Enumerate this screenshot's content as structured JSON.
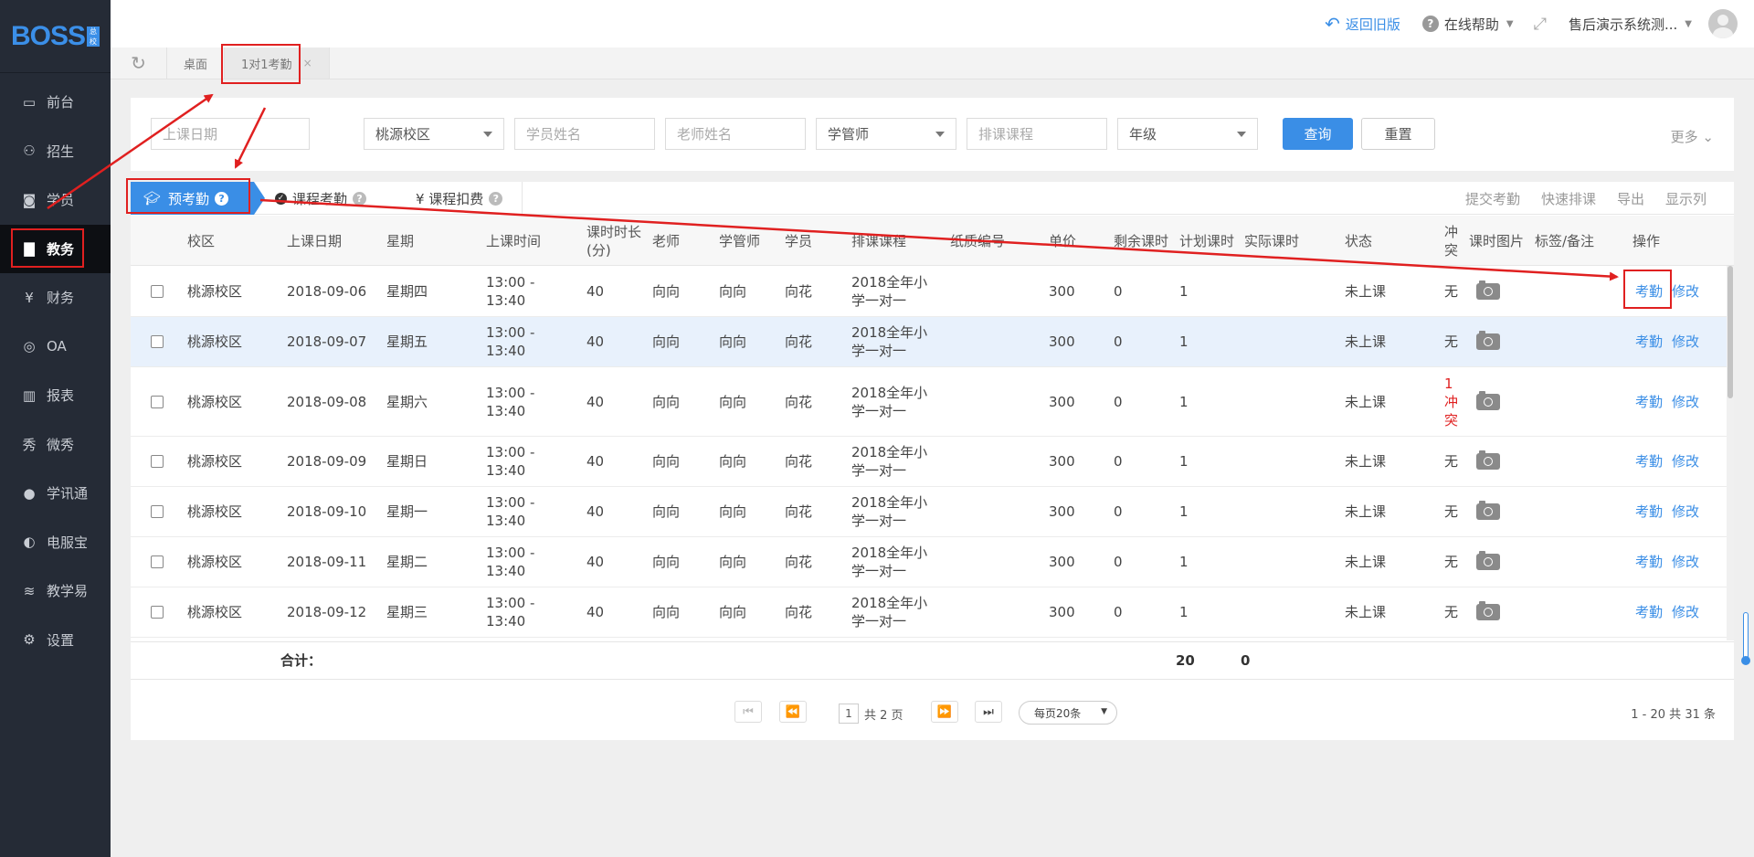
{
  "sidebar": {
    "logo": "BOSS",
    "logo_sub": "总校",
    "items": [
      {
        "label": "前台",
        "icon": "calendar-icon",
        "glyph": "▭"
      },
      {
        "label": "招生",
        "icon": "enroll-icon",
        "glyph": "⚇"
      },
      {
        "label": "学员",
        "icon": "student-icon",
        "glyph": "◙"
      },
      {
        "label": "教务",
        "icon": "book-icon",
        "glyph": "▇",
        "active": true
      },
      {
        "label": "财务",
        "icon": "finance-icon",
        "glyph": "¥"
      },
      {
        "label": "OA",
        "icon": "oa-icon",
        "glyph": "◎"
      },
      {
        "label": "报表",
        "icon": "chart-icon",
        "glyph": "▥"
      },
      {
        "label": "微秀",
        "icon": "weixiu-icon",
        "glyph": "秀"
      },
      {
        "label": "学讯通",
        "icon": "location-icon",
        "glyph": "●"
      },
      {
        "label": "电服宝",
        "icon": "phone-service-icon",
        "glyph": "◐"
      },
      {
        "label": "教学易",
        "icon": "teach-icon",
        "glyph": "≋"
      },
      {
        "label": "设置",
        "icon": "gear-icon",
        "glyph": "⚙"
      }
    ]
  },
  "topbar": {
    "back_old": "返回旧版",
    "online_help": "在线帮助",
    "user": "售后演示系统测..."
  },
  "tabs": [
    {
      "label": "桌面"
    },
    {
      "label": "1对1考勤",
      "active": true
    }
  ],
  "filters": {
    "date_placeholder": "上课日期",
    "campus": "桃源校区",
    "student_placeholder": "学员姓名",
    "teacher_placeholder": "老师姓名",
    "manager": "学管师",
    "course_placeholder": "排课课程",
    "grade": "年级",
    "query": "查询",
    "reset": "重置",
    "more": "更多"
  },
  "subtabs": {
    "pre": "预考勤",
    "course": "课程考勤",
    "deduct": "¥ 课程扣费",
    "actions": [
      "提交考勤",
      "快速排课",
      "导出",
      "显示列"
    ]
  },
  "columns": [
    "校区",
    "上课日期",
    "星期",
    "上课时间",
    "课时时长(分)",
    "老师",
    "学管师",
    "学员",
    "排课课程",
    "纸质编号",
    "单价",
    "剩余课时",
    "计划课时",
    "实际课时",
    "状态",
    "冲突",
    "课时图片",
    "标签/备注",
    "操作"
  ],
  "rows": [
    {
      "campus": "桃源校区",
      "date": "2018-09-06",
      "weekday": "星期四",
      "time": "13:00 - 13:40",
      "duration": "40",
      "teacher": "向向",
      "manager": "向向",
      "student": "向花",
      "course": "2018全年小学一对一",
      "price": "300",
      "remaining": "0",
      "planned": "1",
      "status": "未上课",
      "conflict": "无"
    },
    {
      "campus": "桃源校区",
      "date": "2018-09-07",
      "weekday": "星期五",
      "time": "13:00 - 13:40",
      "duration": "40",
      "teacher": "向向",
      "manager": "向向",
      "student": "向花",
      "course": "2018全年小学一对一",
      "price": "300",
      "remaining": "0",
      "planned": "1",
      "status": "未上课",
      "conflict": "无"
    },
    {
      "campus": "桃源校区",
      "date": "2018-09-08",
      "weekday": "星期六",
      "time": "13:00 - 13:40",
      "duration": "40",
      "teacher": "向向",
      "manager": "向向",
      "student": "向花",
      "course": "2018全年小学一对一",
      "price": "300",
      "remaining": "0",
      "planned": "1",
      "status": "未上课",
      "conflict": "1冲突"
    },
    {
      "campus": "桃源校区",
      "date": "2018-09-09",
      "weekday": "星期日",
      "time": "13:00 - 13:40",
      "duration": "40",
      "teacher": "向向",
      "manager": "向向",
      "student": "向花",
      "course": "2018全年小学一对一",
      "price": "300",
      "remaining": "0",
      "planned": "1",
      "status": "未上课",
      "conflict": "无"
    },
    {
      "campus": "桃源校区",
      "date": "2018-09-10",
      "weekday": "星期一",
      "time": "13:00 - 13:40",
      "duration": "40",
      "teacher": "向向",
      "manager": "向向",
      "student": "向花",
      "course": "2018全年小学一对一",
      "price": "300",
      "remaining": "0",
      "planned": "1",
      "status": "未上课",
      "conflict": "无"
    },
    {
      "campus": "桃源校区",
      "date": "2018-09-11",
      "weekday": "星期二",
      "time": "13:00 - 13:40",
      "duration": "40",
      "teacher": "向向",
      "manager": "向向",
      "student": "向花",
      "course": "2018全年小学一对一",
      "price": "300",
      "remaining": "0",
      "planned": "1",
      "status": "未上课",
      "conflict": "无"
    },
    {
      "campus": "桃源校区",
      "date": "2018-09-12",
      "weekday": "星期三",
      "time": "13:00 - 13:40",
      "duration": "40",
      "teacher": "向向",
      "manager": "向向",
      "student": "向花",
      "course": "2018全年小学一对一",
      "price": "300",
      "remaining": "0",
      "planned": "1",
      "status": "未上课",
      "conflict": "无"
    }
  ],
  "row_ops": {
    "attend": "考勤",
    "edit": "修改"
  },
  "totals": {
    "label": "合计：",
    "planned": "20",
    "actual": "0"
  },
  "pager": {
    "page": "1",
    "pages_text": "共 2 页",
    "page_size": "每页20条",
    "info": "1 - 20   共 31 条"
  },
  "colors": {
    "accent": "#3a8ee6",
    "sidebar": "#252b36",
    "annotation": "#e02020"
  }
}
